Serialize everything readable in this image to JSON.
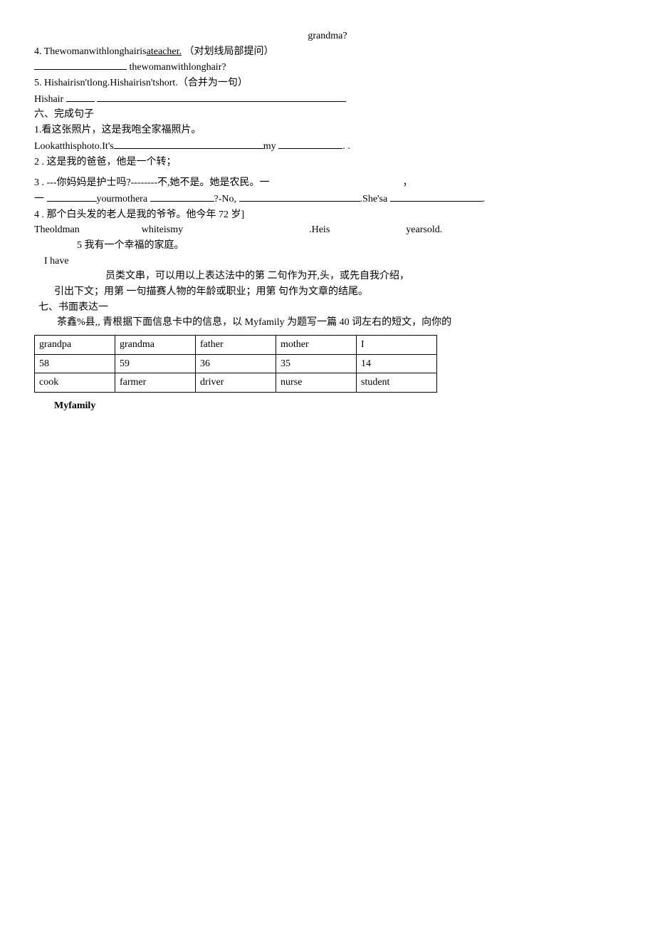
{
  "top_center": "grandma?",
  "q4": {
    "num": "4.",
    "stem_pre": "Thewomanwithlonghairis",
    "stem_underlined": "ateacher.",
    "paren": "（对划线局部提问）",
    "line2_tail": "thewomanwithlonghair?"
  },
  "q5": {
    "num": "5.",
    "stem": "Hishairisn'tlong.Hishairisn'tshort.（合并为一句）",
    "line2_lead": "Hishair"
  },
  "sec6_title": "六、完成句子",
  "c1": {
    "cn": "1.看这张照片，这是我咆全家福照片。",
    "en_lead": "Lookatthisphoto.It's",
    "en_mid": "my"
  },
  "c2": "2 . 这是我的爸爸，他是一个转；",
  "c3": {
    "cn": "3 . ---你妈妈是护士吗?--------不,她不是。她是农民。一",
    "comma": "，",
    "dash": "一",
    "en_a": "yourmothera",
    "en_b": "?-No,",
    "en_c": ".She'sa",
    "en_d": "."
  },
  "c4": {
    "cn": "4 . 那个白头发的老人是我的爷爷。他今年 72 岁]",
    "en_a": "Theoldman",
    "en_b": "whiteismy",
    "en_c": ".Heis",
    "en_d": "yearsold."
  },
  "c5_cn": "5 我有一个幸福的家庭。",
  "c5_en": "I have",
  "tip1": "员类文串，可以用以上表达法中的第   二句作为开,头，或先自我介绍，",
  "tip2": "引出下文；用第     一句描赛人物的年龄或职业；用第     句作为文章的结尾。",
  "sec7_title": "七、书面表达一",
  "sec7_desc": "茶鑫%县,, 青根据下面信息卡中的信息，以 Myfamily 为题写一篇 40 词左右的短文，向你的",
  "table": {
    "r1": [
      "grandpa",
      "grandma",
      "father",
      "mother",
      "I"
    ],
    "r2": [
      "58",
      "59",
      "36",
      "35",
      "14"
    ],
    "r3": [
      "cook",
      "farmer",
      "driver",
      "nurse",
      "student"
    ]
  },
  "title_myfamily": "Myfamily"
}
